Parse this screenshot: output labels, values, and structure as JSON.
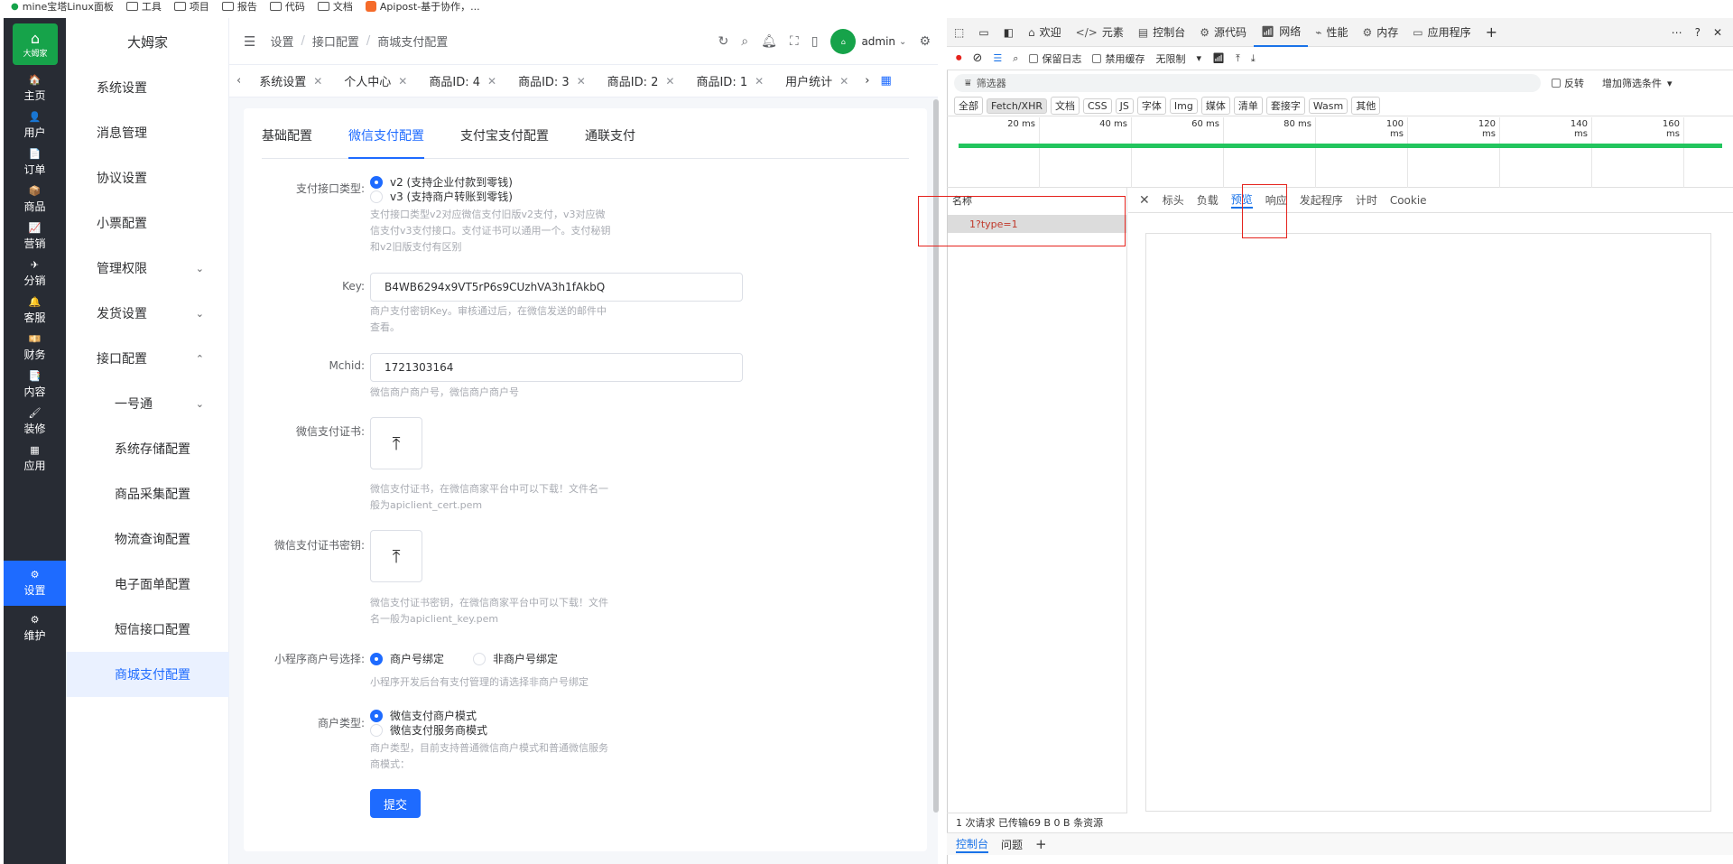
{
  "bookmarks": [
    "mine宝塔Linux面板",
    "工具",
    "项目",
    "报告",
    "代码",
    "文档",
    "Apipost-基于协作，..."
  ],
  "app": {
    "logo_text": "大姆家",
    "brand": "大姆家"
  },
  "rail": [
    {
      "label": "主页",
      "icon": "🏠"
    },
    {
      "label": "用户",
      "icon": "👤"
    },
    {
      "label": "订单",
      "icon": "📄"
    },
    {
      "label": "商品",
      "icon": "📦"
    },
    {
      "label": "营销",
      "icon": "📈"
    },
    {
      "label": "分销",
      "icon": "✈"
    },
    {
      "label": "客服",
      "icon": "🔔"
    },
    {
      "label": "财务",
      "icon": "💴"
    },
    {
      "label": "内容",
      "icon": "📑"
    },
    {
      "label": "装修",
      "icon": "🖌"
    },
    {
      "label": "应用",
      "icon": "▦"
    },
    {
      "label": "设置",
      "icon": "⚙"
    },
    {
      "label": "维护",
      "icon": "⚙"
    }
  ],
  "menu": [
    {
      "label": "系统设置",
      "chev": ""
    },
    {
      "label": "消息管理",
      "chev": ""
    },
    {
      "label": "协议设置",
      "chev": ""
    },
    {
      "label": "小票配置",
      "chev": ""
    },
    {
      "label": "管理权限",
      "chev": "⌄"
    },
    {
      "label": "发货设置",
      "chev": "⌄"
    },
    {
      "label": "接口配置",
      "chev": "⌃"
    },
    {
      "label": "一号通",
      "chev": "⌄"
    },
    {
      "label": "系统存储配置",
      "chev": ""
    },
    {
      "label": "商品采集配置",
      "chev": ""
    },
    {
      "label": "物流查询配置",
      "chev": ""
    },
    {
      "label": "电子面单配置",
      "chev": ""
    },
    {
      "label": "短信接口配置",
      "chev": ""
    },
    {
      "label": "商城支付配置",
      "chev": ""
    }
  ],
  "breadcrumb": [
    "设置",
    "接口配置",
    "商城支付配置"
  ],
  "header": {
    "user": "admin"
  },
  "tabs": [
    "系统设置",
    "个人中心",
    "商品ID: 4",
    "商品ID: 3",
    "商品ID: 2",
    "商品ID: 1",
    "用户统计"
  ],
  "subtabs": [
    "基础配置",
    "微信支付配置",
    "支付宝支付配置",
    "通联支付"
  ],
  "form": {
    "pay_type_label": "支付接口类型:",
    "pay_type_opt1": "v2 (支持企业付款到零钱)",
    "pay_type_opt2": "v3 (支持商户转账到零钱)",
    "pay_type_hint": "支付接口类型v2对应微信支付旧版v2支付，v3对应微信支付v3支付接口。支付证书可以通用一个。支付秘钥和v2旧版支付有区别",
    "key_label": "Key:",
    "key_value": "B4WB6294x9VT5rP6s9CUzhVA3h1fAkbQ",
    "key_hint": "商户支付密钥Key。审核通过后，在微信发送的邮件中查看。",
    "mchid_label": "Mchid:",
    "mchid_value": "1721303164",
    "mchid_hint": "微信商户商户号，微信商户商户号",
    "cert_label": "微信支付证书:",
    "cert_hint": "微信支付证书，在微信商家平台中可以下载！文件名一般为apiclient_cert.pem",
    "certkey_label": "微信支付证书密钥:",
    "certkey_hint": "微信支付证书密钥，在微信商家平台中可以下载！文件名一般为apiclient_key.pem",
    "mp_label": "小程序商户号选择:",
    "mp_opt1": "商户号绑定",
    "mp_opt2": "非商户号绑定",
    "mp_hint": "小程序开发后台有支付管理的请选择非商户号绑定",
    "merchant_label": "商户类型:",
    "merchant_opt1": "微信支付商户模式",
    "merchant_opt2": "微信支付服务商模式",
    "merchant_hint": "商户类型，目前支持普通微信商户模式和普通微信服务商模式：",
    "submit": "提交"
  },
  "devtools": {
    "tabs": [
      "欢迎",
      "元素",
      "控制台",
      "源代码",
      "网络",
      "性能",
      "内存",
      "应用程序"
    ],
    "preserve_log": "保留日志",
    "disable_cache": "禁用缓存",
    "throttle": "无限制",
    "filter_placeholder": "筛选器",
    "invert": "反转",
    "more_filters": "增加筛选条件",
    "types": [
      "全部",
      "Fetch/XHR",
      "文档",
      "CSS",
      "JS",
      "字体",
      "Img",
      "媒体",
      "清单",
      "套接字",
      "Wasm",
      "其他"
    ],
    "ticks": [
      "20 ms",
      "40 ms",
      "60 ms",
      "80 ms",
      "100 ms",
      "120 ms",
      "140 ms",
      "160 ms"
    ],
    "name_header": "名称",
    "request_name": "1?type=1",
    "panel_tabs": [
      "标头",
      "负载",
      "预览",
      "响应",
      "发起程序",
      "计时",
      "Cookie"
    ],
    "status": "1 次请求  已传输69 B  0 B 条资源",
    "drawer": [
      "控制台",
      "问题"
    ]
  }
}
